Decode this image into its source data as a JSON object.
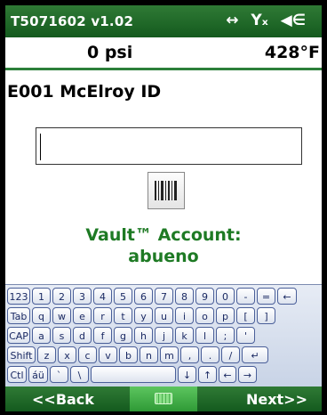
{
  "statusbar": {
    "title": "T5071602 v1.02",
    "connectivity_icon": "↔",
    "signal_icon": "Yₓ",
    "volume_icon": "◀∈"
  },
  "readings": {
    "pressure": "0 psi",
    "temperature": "428°F"
  },
  "prompt": "E001 McElroy ID",
  "input": {
    "value": ""
  },
  "vault": {
    "label": "Vault™ Account:",
    "user": "abueno"
  },
  "keyboard": {
    "rows": [
      [
        "123",
        "1",
        "2",
        "3",
        "4",
        "5",
        "6",
        "7",
        "8",
        "9",
        "0",
        "-",
        "=",
        "←"
      ],
      [
        "Tab",
        "q",
        "w",
        "e",
        "r",
        "t",
        "y",
        "u",
        "i",
        "o",
        "p",
        "[",
        "]"
      ],
      [
        "CAP",
        "a",
        "s",
        "d",
        "f",
        "g",
        "h",
        "j",
        "k",
        "l",
        ";",
        "'"
      ],
      [
        "Shift",
        "z",
        "x",
        "c",
        "v",
        "b",
        "n",
        "m",
        ",",
        ".",
        "/",
        "↵"
      ],
      [
        "Ctl",
        "áü",
        "`",
        "\\",
        " ",
        "↓",
        "↑",
        "←",
        "→"
      ]
    ]
  },
  "bottombar": {
    "back_label": "<<Back",
    "next_label": "Next>>"
  },
  "colors": {
    "bar_green": "#1f6b27",
    "accent_green": "#1e7a24"
  }
}
